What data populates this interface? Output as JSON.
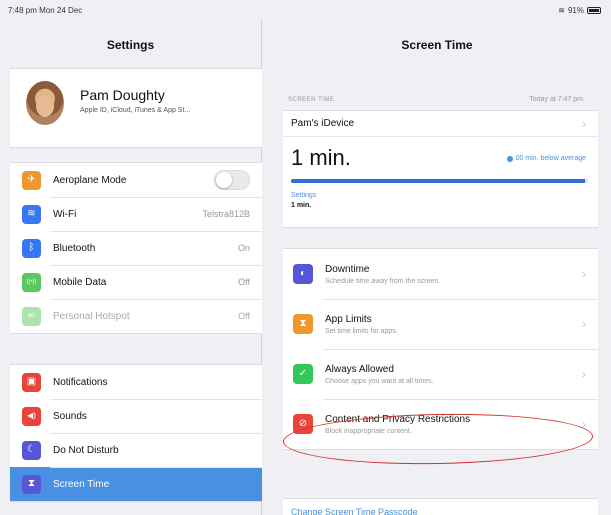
{
  "status": {
    "time_date": "7:48 pm  Mon 24 Dec",
    "battery": "91%"
  },
  "left": {
    "title": "Settings",
    "profile": {
      "name": "Pam Doughty",
      "subtitle": "Apple ID, iCloud, iTunes & App St..."
    },
    "group1": [
      {
        "label": "Aeroplane Mode",
        "value": "",
        "icon": "airplane-icon",
        "color": "#f0962e",
        "glyph": "✈"
      },
      {
        "label": "Wi-Fi",
        "value": "Telstra812B",
        "icon": "wifi-icon",
        "color": "#3478f6",
        "glyph": "≋"
      },
      {
        "label": "Bluetooth",
        "value": "On",
        "icon": "bluetooth-icon",
        "color": "#3478f6",
        "glyph": "ᛒ"
      },
      {
        "label": "Mobile Data",
        "value": "Off",
        "icon": "antenna-icon",
        "color": "#5ac85a",
        "glyph": "((•))"
      },
      {
        "label": "Personal Hotspot",
        "value": "Off",
        "icon": "hotspot-icon",
        "color": "#5ac85a",
        "glyph": "∞"
      }
    ],
    "group2": [
      {
        "label": "Notifications",
        "icon": "notifications-icon",
        "color": "#e8443a",
        "glyph": "▣"
      },
      {
        "label": "Sounds",
        "icon": "sounds-icon",
        "color": "#e8443a",
        "glyph": "◀)"
      },
      {
        "label": "Do Not Disturb",
        "icon": "moon-icon",
        "color": "#5856d6",
        "glyph": "☾"
      },
      {
        "label": "Screen Time",
        "icon": "hourglass-icon",
        "color": "#5856d6",
        "glyph": "⧗"
      }
    ]
  },
  "right": {
    "title": "Screen Time",
    "section_header": "SCREEN TIME",
    "section_date": "Today at 7:47 pm",
    "device": "Pam's iDevice",
    "usage": "1 min.",
    "average_label": "00 min. below average",
    "usage_progress": 0.99,
    "category_label": "Settings",
    "category_value": "1 min.",
    "features": [
      {
        "title": "Downtime",
        "subtitle": "Schedule time away from the screen.",
        "icon": "downtime-icon",
        "color": "#5856d6",
        "glyph": "◐"
      },
      {
        "title": "App Limits",
        "subtitle": "Set time limits for apps.",
        "icon": "app-limits-icon",
        "color": "#f0962e",
        "glyph": "⧗"
      },
      {
        "title": "Always Allowed",
        "subtitle": "Choose apps you want at all times.",
        "icon": "always-allowed-icon",
        "color": "#34c759",
        "glyph": "✓"
      },
      {
        "title": "Content and Privacy Restrictions",
        "subtitle": "Block inappropriate content.",
        "icon": "restrictions-icon",
        "color": "#e8443a",
        "glyph": "⊘"
      }
    ],
    "passcode_link": "Change Screen Time Passcode"
  },
  "colors": {
    "accent": "#4a90e2",
    "highlight_circle": "#d0302a",
    "selected_row": "#4a90e2"
  }
}
